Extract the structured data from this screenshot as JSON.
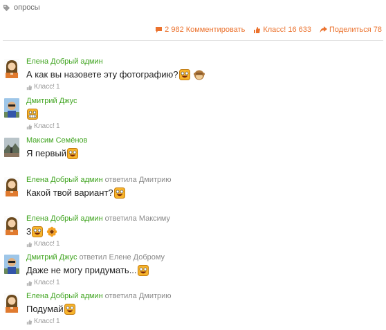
{
  "tag": {
    "label": "опросы",
    "icon": "tag-icon"
  },
  "actions": {
    "comment": {
      "count": "2 982",
      "label": "Комментировать",
      "icon": "speech-bubble-icon"
    },
    "klass": {
      "label": "Класс!",
      "count": "16 633",
      "icon": "thumbs-up-icon"
    },
    "share": {
      "label": "Поделиться",
      "count": "78",
      "icon": "share-arrow-icon"
    }
  },
  "colors": {
    "accent": "#eb722e",
    "author": "#3fa41f",
    "muted": "#8a8a8a"
  },
  "comments": [
    {
      "author": "Елена Добрый админ",
      "reply_to": "",
      "text": "А как вы назовете эту фотографию?",
      "smiles": [
        "laughing-smiley-icon",
        "monkey-covering-eyes-icon"
      ],
      "klass_label": "Класс!",
      "klass_count": "1"
    },
    {
      "author": "Дмитрий Джус",
      "reply_to": "",
      "text": "",
      "smiles": [
        "grinning-smiley-icon"
      ],
      "klass_label": "Класс!",
      "klass_count": "1"
    },
    {
      "author": "Максим Семёнов",
      "reply_to": "",
      "text": "Я первый",
      "smiles": [
        "laughing-smiley-icon"
      ],
      "klass_label": "",
      "klass_count": ""
    },
    {
      "author": "Елена Добрый админ",
      "reply_to": "ответила Дмитрию",
      "text": "Какой твой вариант?",
      "smiles": [
        "laughing-smiley-icon"
      ],
      "klass_label": "",
      "klass_count": ""
    },
    {
      "author": "Елена Добрый админ",
      "reply_to": "ответила Максиму",
      "text": "3",
      "smiles": [
        "laughing-smiley-icon",
        "flower-icon"
      ],
      "klass_label": "Класс!",
      "klass_count": "1"
    },
    {
      "author": "Дмитрий Джус",
      "reply_to": "ответил Елене Доброму",
      "text": "Даже не могу придумать...",
      "smiles": [
        "laughing-smiley-icon"
      ],
      "klass_label": "Класс!",
      "klass_count": "1"
    },
    {
      "author": "Елена Добрый админ",
      "reply_to": "ответила Дмитрию",
      "text": "Подумай",
      "smiles": [
        "laughing-smiley-icon"
      ],
      "klass_label": "Класс!",
      "klass_count": "1"
    }
  ]
}
